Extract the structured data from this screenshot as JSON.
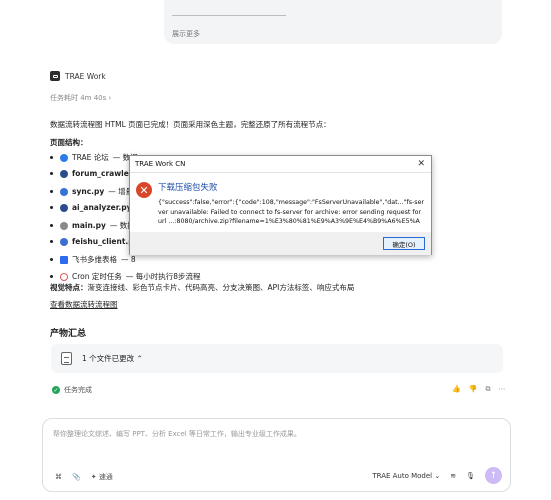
{
  "top_card": {
    "more_label": "展示更多"
  },
  "agent": {
    "name": "TRAE Work",
    "elapsed": "任务耗时 4m 40s ›"
  },
  "message": {
    "summary": "数据流转流程图 HTML 页面已完成！页面采用深色主题，完整还原了所有流程节点：",
    "structure_title": "页面结构：",
    "items": [
      {
        "name": "TRAE 论坛",
        "rest": " — 数据",
        "icon_color": "#2b7de9"
      },
      {
        "name": "forum_crawler.py",
        "rest": "",
        "icon_color": "#2a4b8d"
      },
      {
        "name": "sync.py",
        "rest": " — 增量",
        "icon_color": "#3572d6"
      },
      {
        "name": "ai_analyzer.py",
        "rest": "",
        "icon_color": "#2a4b8d"
      },
      {
        "name": "main.py",
        "rest": " — 数据",
        "icon_color": "#8a8a8a"
      },
      {
        "name": "feishu_client.py",
        "rest": "",
        "icon_color": "#3d6fd1"
      },
      {
        "name": "飞书多维表格",
        "rest": " — 8",
        "icon_color": "#2c6bed"
      },
      {
        "name": "Cron 定时任务",
        "rest": " — 每小时执行8步流程",
        "icon_color": "#e05a5a"
      }
    ],
    "visual_label": "视觉特点：",
    "visual_text": "渐变连接线、彩色节点卡片、代码高亮、分支决策图、API方法标签、响应式布局",
    "link": "查看数据流转流程图"
  },
  "artifacts": {
    "title": "产物汇总",
    "files_label": "1 个文件已更改"
  },
  "status": {
    "done": "任务完成"
  },
  "composer": {
    "placeholder": "帮你整理论文综述、编写 PPT、分析 Excel 等日常工作，输出专业级工作成果。",
    "speed_label": "速通",
    "model": "TRAE Auto Model"
  },
  "dialog": {
    "title": "TRAE Work CN",
    "heading": "下载压缩包失败",
    "message": "{\"success\":false,\"error\":{\"code\":108,\"message\":\"FsServerUnavailable\",\"dat...\"fs-server unavailable: Failed to connect to fs-server for archive: error sending request for url ...:8080/archive.zip?filename=1%E3%80%81%E9%A3%9E%E4%B9%A6%E5%A4%9A...",
    "ok_label": "确定(O)"
  },
  "colors": {
    "accent": "#cdbbf5",
    "error": "#d9472b",
    "dialog_heading": "#1e4fa8",
    "done": "#22a55a"
  }
}
